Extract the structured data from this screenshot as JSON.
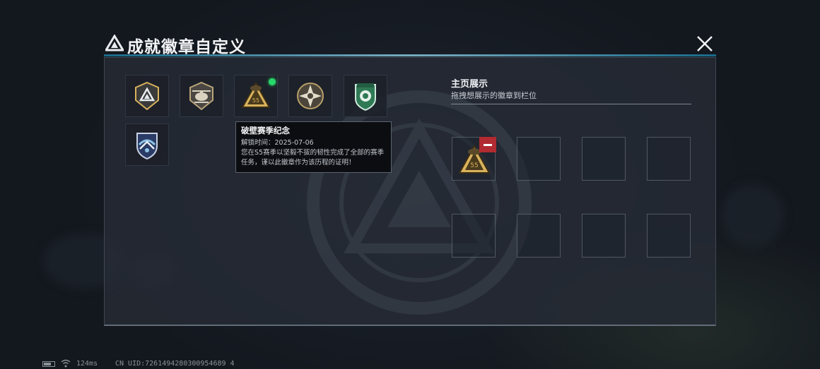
{
  "header": {
    "title": "成就徽章自定义",
    "close_icon": "close-icon",
    "logo_icon": "triangle-logo-icon"
  },
  "badges": [
    {
      "name": "triangle-emblem-badge",
      "new": false
    },
    {
      "name": "helicopter-badge",
      "new": false
    },
    {
      "name": "season-s5-badge",
      "new": true
    },
    {
      "name": "star-compass-badge",
      "new": false
    },
    {
      "name": "green-shield-badge",
      "new": false
    },
    {
      "name": "wings-crest-badge",
      "new": false
    }
  ],
  "tooltip": {
    "title": "破壁赛季纪念",
    "date_label": "解锁时间：",
    "date_value": "2025-07-06",
    "description_line1": "您在S5赛季以坚毅不拔的韧性完成了全部的赛季",
    "description_line2": "任务，谨以此徽章作为该历程的证明！"
  },
  "display": {
    "title": "主页展示",
    "subtitle": "拖拽想展示的徽章到栏位",
    "slots": [
      {
        "badge": "season-s5-badge"
      },
      {
        "badge": null
      },
      {
        "badge": null
      },
      {
        "badge": null
      },
      {
        "badge": null
      },
      {
        "badge": null
      },
      {
        "badge": null
      },
      {
        "badge": null
      }
    ]
  },
  "footer": {
    "ping": "124ms",
    "uid": "CN UID:7261494280300954689 4"
  },
  "colors": {
    "accent_line": "#8ecfe5",
    "new_dot": "#26d86a",
    "remove_button": "#b12b30",
    "gold": "#d8b25c"
  }
}
